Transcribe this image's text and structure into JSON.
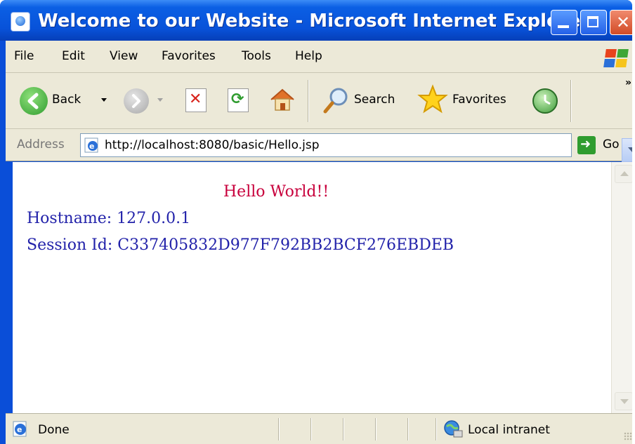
{
  "window": {
    "title": "Welcome to our Website - Microsoft Internet Explorer"
  },
  "menu": {
    "items": [
      "File",
      "Edit",
      "View",
      "Favorites",
      "Tools",
      "Help"
    ]
  },
  "toolbar": {
    "back_label": "Back",
    "search_label": "Search",
    "favorites_label": "Favorites",
    "more_chevron": "»"
  },
  "address": {
    "label": "Address",
    "url": "http://localhost:8080/basic/Hello.jsp",
    "go_label": "Go"
  },
  "page": {
    "heading": "Hello World!!",
    "hostname_line": "Hostname: 127.0.0.1",
    "session_line": "Session Id: C337405832D977F792BB2BCF276EBDEB"
  },
  "status": {
    "text": "Done",
    "zone": "Local intranet"
  },
  "colors": {
    "title_bar": "#0852d9",
    "chrome": "#ece9d8",
    "heading_text": "#c8003c",
    "body_text": "#2222aa"
  },
  "icons": [
    "ie-page-icon",
    "minimize-icon",
    "maximize-icon",
    "close-icon",
    "windows-logo-icon",
    "back-arrow-icon",
    "forward-arrow-icon",
    "stop-icon",
    "refresh-icon",
    "home-icon",
    "search-magnifier-icon",
    "favorites-star-icon",
    "history-icon",
    "go-arrow-icon",
    "local-intranet-icon"
  ]
}
